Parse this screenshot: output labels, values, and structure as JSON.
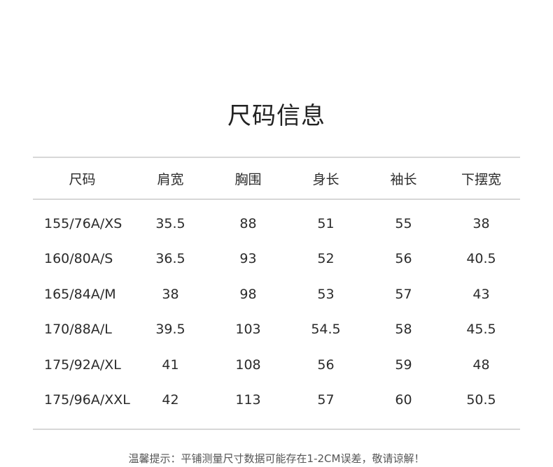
{
  "title": "尺码信息",
  "table": {
    "headers": [
      "尺码",
      "肩宽",
      "胸围",
      "身长",
      "袖长",
      "下摆宽"
    ],
    "rows": [
      [
        "155/76A/XS",
        "35.5",
        "88",
        "51",
        "55",
        "38"
      ],
      [
        "160/80A/S",
        "36.5",
        "93",
        "52",
        "56",
        "40.5"
      ],
      [
        "165/84A/M",
        "38",
        "98",
        "53",
        "57",
        "43"
      ],
      [
        "170/88A/L",
        "39.5",
        "103",
        "54.5",
        "58",
        "45.5"
      ],
      [
        "175/92A/XL",
        "41",
        "108",
        "56",
        "59",
        "48"
      ],
      [
        "175/96A/XXL",
        "42",
        "113",
        "57",
        "60",
        "50.5"
      ]
    ]
  },
  "footer_note": "温馨提示：平铺测量尺寸数据可能存在1-2CM误差，敬请谅解！"
}
